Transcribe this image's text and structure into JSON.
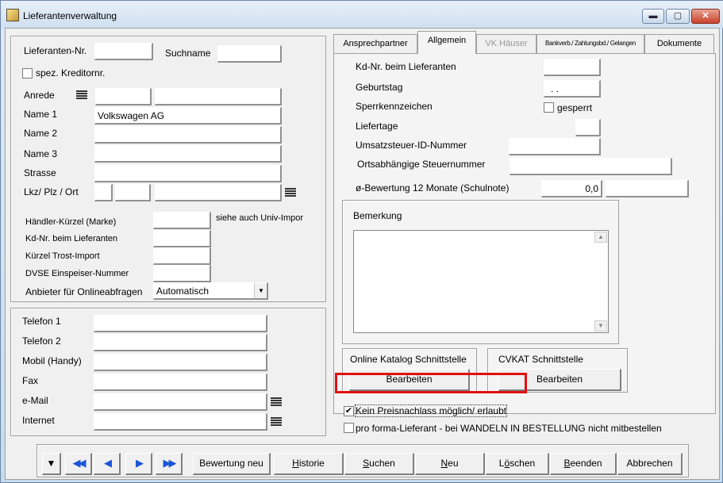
{
  "window": {
    "title": "Lieferantenverwaltung",
    "min_glyph": "▬",
    "max_glyph": "▢",
    "close_glyph": "✕"
  },
  "left": {
    "lieferanten_nr": {
      "label": "Lieferanten-Nr.",
      "value": ""
    },
    "suchname": {
      "label": "Suchname",
      "value": ""
    },
    "spez_kreditornr": {
      "label": "spez. Kreditornr.",
      "checked": false
    },
    "anrede": {
      "label": "Anrede",
      "value1": "",
      "value2": ""
    },
    "name1": {
      "label": "Name 1",
      "value": "Volkswagen AG"
    },
    "name2": {
      "label": "Name 2",
      "value": ""
    },
    "name3": {
      "label": "Name 3",
      "value": ""
    },
    "strasse": {
      "label": "Strasse",
      "value": ""
    },
    "lkz_plz_ort": {
      "label": "Lkz/ Plz / Ort",
      "lkz": "",
      "plz": "",
      "ort": ""
    },
    "haendler_kuerzel": {
      "label": "Händler-Kürzel (Marke)",
      "value": "",
      "hint": "siehe auch Univ-Impor"
    },
    "kd_nr": {
      "label": "Kd-Nr. beim Lieferanten",
      "value": ""
    },
    "kuerzel_trost": {
      "label": "Kürzel Trost-Import",
      "value": ""
    },
    "dvse": {
      "label": "DVSE Einspeiser-Nummer",
      "value": ""
    },
    "anbieter": {
      "label": "Anbieter für Onlineabfragen",
      "value": "Automatisch"
    }
  },
  "contact": {
    "telefon1": {
      "label": "Telefon 1",
      "value": ""
    },
    "telefon2": {
      "label": "Telefon 2",
      "value": ""
    },
    "mobil": {
      "label": "Mobil (Handy)",
      "value": ""
    },
    "fax": {
      "label": "Fax",
      "value": ""
    },
    "email": {
      "label": "e-Mail",
      "value": ""
    },
    "internet": {
      "label": "Internet",
      "value": ""
    }
  },
  "tabs": [
    "Ansprechpartner",
    "Allgemein",
    "VK Häuser",
    "Bankverb./ Zahlungsbd./ Gelangen",
    "Dokumente"
  ],
  "allgemein": {
    "kd_nr": {
      "label": "Kd-Nr. beim Lieferanten",
      "value": ""
    },
    "geburtstag": {
      "label": "Geburtstag",
      "value": ". ."
    },
    "sperrkennzeichen": {
      "label": "Sperrkennzeichen",
      "checkbox": "gesperrt",
      "checked": false
    },
    "liefertage": {
      "label": "Liefertage",
      "value": ""
    },
    "ust_id": {
      "label": "Umsatzsteuer-ID-Nummer",
      "value": ""
    },
    "steuernummer": {
      "label": "Ortsabhängige Steuernummer",
      "value": ""
    },
    "bewertung": {
      "label": "ø-Bewertung 12 Monate (Schulnote)",
      "value": "0,0",
      "extra": ""
    },
    "bemerkung": {
      "label": "Bemerkung",
      "value": ""
    },
    "online_katalog": {
      "title": "Online Katalog Schnittstelle",
      "button": "Bearbeiten"
    },
    "cvkat": {
      "title": "CVKAT Schnittstelle",
      "button": "Bearbeiten"
    }
  },
  "options": {
    "kein_preisnachlass": {
      "label": "Kein Preisnachlass möglich/ erlaubt",
      "checked": true
    },
    "pro_forma": {
      "label": "pro forma-Lieferant - bei WANDELN IN BESTELLUNG nicht mitbestellen",
      "checked": false
    }
  },
  "toolbar": {
    "dropdown_glyph": "▼",
    "nav": [
      {
        "name": "first",
        "glyph": "◀◀"
      },
      {
        "name": "prev",
        "glyph": "◀"
      },
      {
        "name": "next",
        "glyph": "▶"
      },
      {
        "name": "last",
        "glyph": "▶▶"
      }
    ],
    "bewertung_neu": "Bewertung neu",
    "historie": {
      "accel": "H",
      "rest": "istorie"
    },
    "suchen": {
      "accel": "S",
      "rest": "uchen"
    },
    "neu": {
      "accel": "N",
      "rest": "eu"
    },
    "loeschen": {
      "pre": "L",
      "accel": "ö",
      "rest": "schen"
    },
    "beenden": {
      "accel": "B",
      "rest": "eenden"
    },
    "abbrechen": "Abbrechen"
  },
  "colors": {
    "highlight": "#e01010",
    "nav_arrows": "#1a55d8"
  }
}
